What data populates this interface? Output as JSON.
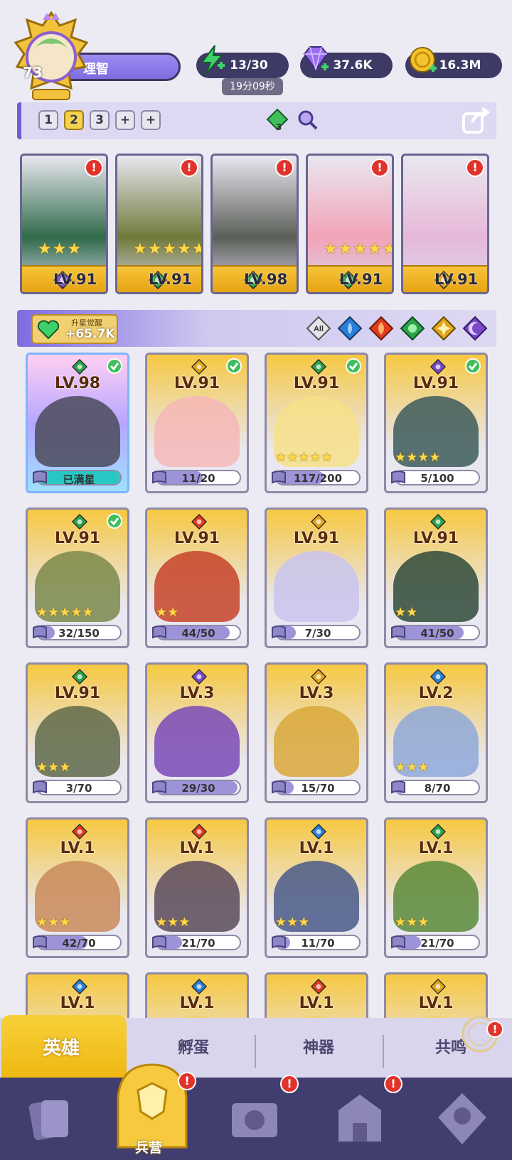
{
  "player": {
    "level": "73",
    "name": "理智"
  },
  "resources": {
    "energy": "13/30",
    "energy_timer": "19分09秒",
    "gems": "37.6K",
    "gold": "16.3M"
  },
  "team_bar": {
    "slots": [
      "1",
      "2",
      "3",
      "+",
      "+"
    ],
    "selected_slot": "2",
    "element_count": "3"
  },
  "team": [
    {
      "level": "LV.91",
      "element": "moon",
      "stars": "★★★",
      "color": "#2f6b4a"
    },
    {
      "level": "LV.91",
      "element": "leaf",
      "stars": "★★★★★",
      "color": "#6f7a3a"
    },
    {
      "level": "LV.98",
      "element": "leaf",
      "stars": "",
      "color": "#5b5f58"
    },
    {
      "level": "LV.91",
      "element": "leaf",
      "stars": "★★★★★",
      "color": "#f2a3b8"
    },
    {
      "level": "LV.91",
      "element": "light",
      "stars": "",
      "color": "#e6b8d8"
    }
  ],
  "awaken": {
    "label": "升星觉醒",
    "value": "+65.7K"
  },
  "filters": {
    "all_label": "All"
  },
  "heroes": [
    {
      "level": "LV.98",
      "element": "leaf",
      "progress": "已满星",
      "fill": 1.0,
      "stars": "",
      "checked": true,
      "color": "#4b4a5a"
    },
    {
      "level": "LV.91",
      "element": "light",
      "progress": "11/20",
      "fill": 0.55,
      "stars": "",
      "checked": true,
      "color": "#f4b7b7"
    },
    {
      "level": "LV.91",
      "element": "leaf",
      "progress": "117/200",
      "fill": 0.58,
      "stars": "★★★★★",
      "checked": true,
      "color": "#f7e18a"
    },
    {
      "level": "LV.91",
      "element": "moon",
      "progress": "5/100",
      "fill": 0.05,
      "stars": "★★★★",
      "checked": true,
      "color": "#3d5a5a"
    },
    {
      "level": "LV.91",
      "element": "leaf",
      "progress": "32/150",
      "fill": 0.21,
      "stars": "★★★★★",
      "checked": true,
      "color": "#7a8a4a"
    },
    {
      "level": "LV.91",
      "element": "fire",
      "progress": "44/50",
      "fill": 0.88,
      "stars": "★★",
      "checked": false,
      "color": "#c7432a"
    },
    {
      "level": "LV.91",
      "element": "light",
      "progress": "7/30",
      "fill": 0.23,
      "stars": "",
      "checked": false,
      "color": "#c9c4ef"
    },
    {
      "level": "LV.91",
      "element": "leaf",
      "progress": "41/50",
      "fill": 0.82,
      "stars": "★★",
      "checked": false,
      "color": "#2f4a3a"
    },
    {
      "level": "LV.91",
      "element": "leaf",
      "progress": "3/70",
      "fill": 0.04,
      "stars": "★★★",
      "checked": false,
      "color": "#5f6a4a"
    },
    {
      "level": "LV.3",
      "element": "moon",
      "progress": "29/30",
      "fill": 0.97,
      "stars": "",
      "checked": false,
      "color": "#7a4ab8"
    },
    {
      "level": "LV.3",
      "element": "light",
      "progress": "15/70",
      "fill": 0.21,
      "stars": "",
      "checked": false,
      "color": "#d9a83a"
    },
    {
      "level": "LV.2",
      "element": "water",
      "progress": "8/70",
      "fill": 0.11,
      "stars": "★★★",
      "checked": false,
      "color": "#8fa8d8"
    },
    {
      "level": "LV.1",
      "element": "fire",
      "progress": "42/70",
      "fill": 0.6,
      "stars": "★★★",
      "checked": false,
      "color": "#c98a5a"
    },
    {
      "level": "LV.1",
      "element": "fire",
      "progress": "21/70",
      "fill": 0.3,
      "stars": "★★★",
      "checked": false,
      "color": "#5a4a5a"
    },
    {
      "level": "LV.1",
      "element": "water",
      "progress": "11/70",
      "fill": 0.16,
      "stars": "★★★",
      "checked": false,
      "color": "#4a5a8a"
    },
    {
      "level": "LV.1",
      "element": "leaf",
      "progress": "21/70",
      "fill": 0.3,
      "stars": "★★★",
      "checked": false,
      "color": "#5a8a3a"
    },
    {
      "level": "LV.1",
      "element": "water",
      "progress": "",
      "fill": 0,
      "stars": "",
      "checked": false,
      "color": "#f2d06a"
    },
    {
      "level": "LV.1",
      "element": "water",
      "progress": "",
      "fill": 0,
      "stars": "",
      "checked": false,
      "color": "#f2d06a"
    },
    {
      "level": "LV.1",
      "element": "fire",
      "progress": "",
      "fill": 0,
      "stars": "",
      "checked": false,
      "color": "#f2d06a"
    },
    {
      "level": "LV.1",
      "element": "light",
      "progress": "",
      "fill": 0,
      "stars": "",
      "checked": false,
      "color": "#f2d06a"
    }
  ],
  "tabs": {
    "hero": "英雄",
    "hatch": "孵蛋",
    "artifact": "神器",
    "resonance": "共鸣"
  },
  "nav": {
    "barracks": "兵营"
  },
  "colors": {
    "leaf": "#2ea24a",
    "fire": "#e23b1e",
    "water": "#2a7fd8",
    "light": "#e0a51a",
    "moon": "#7a4acb",
    "accent": "#f6c23a",
    "nav_bg": "#413d6e"
  }
}
